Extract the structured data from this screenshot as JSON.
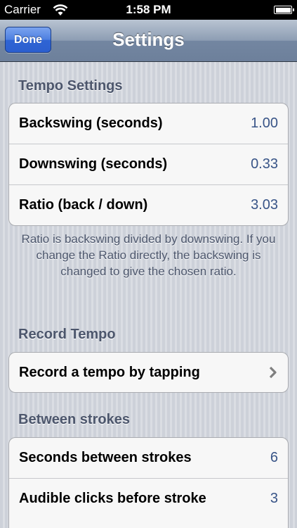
{
  "status_bar": {
    "carrier": "Carrier",
    "time": "1:58 PM"
  },
  "nav": {
    "title": "Settings",
    "done_label": "Done"
  },
  "sections": {
    "tempo": {
      "header": "Tempo Settings",
      "rows": [
        {
          "label": "Backswing (seconds)",
          "value": "1.00"
        },
        {
          "label": "Downswing (seconds)",
          "value": "0.33"
        },
        {
          "label": "Ratio (back / down)",
          "value": "3.03"
        }
      ],
      "footer": "Ratio is backswing divided by downswing. If you change the Ratio directly, the backswing is changed to give the chosen ratio."
    },
    "record": {
      "header": "Record Tempo",
      "row_label": "Record a tempo by tapping"
    },
    "between": {
      "header": "Between strokes",
      "rows": [
        {
          "label": "Seconds between strokes",
          "value": "6"
        },
        {
          "label": "Audible clicks before stroke",
          "value": "3"
        }
      ]
    }
  },
  "colors": {
    "value_text": "#385487",
    "section_header": "#4c566c",
    "done_button": "#2f64d4"
  }
}
